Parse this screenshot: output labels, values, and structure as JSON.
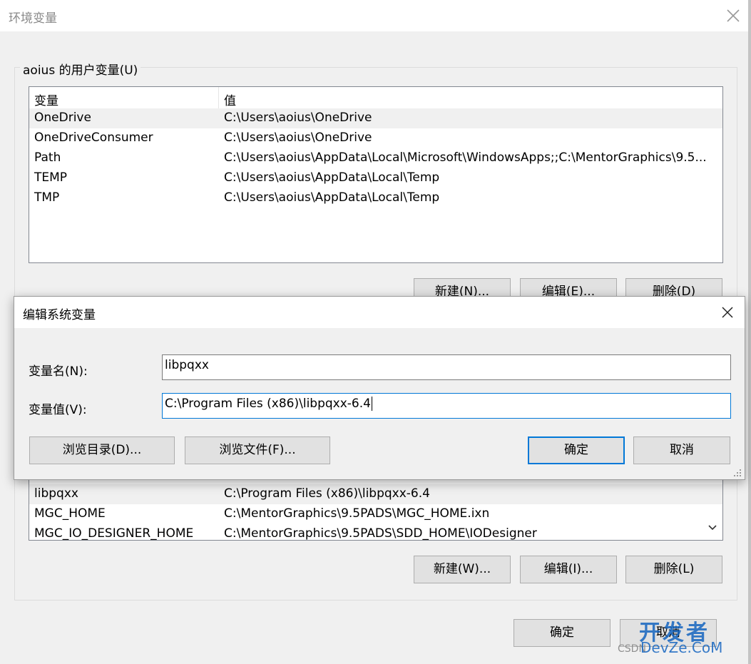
{
  "background_dialog": {
    "title": "环境变量",
    "user_group_label": "aoius 的用户变量(U)",
    "user_table": {
      "columns": [
        "变量",
        "值"
      ],
      "rows": [
        {
          "name": "OneDrive",
          "value": "C:\\Users\\aoius\\OneDrive"
        },
        {
          "name": "OneDriveConsumer",
          "value": "C:\\Users\\aoius\\OneDrive"
        },
        {
          "name": "Path",
          "value": "C:\\Users\\aoius\\AppData\\Local\\Microsoft\\WindowsApps;;C:\\MentorGraphics\\9.5..."
        },
        {
          "name": "TEMP",
          "value": "C:\\Users\\aoius\\AppData\\Local\\Temp"
        },
        {
          "name": "TMP",
          "value": "C:\\Users\\aoius\\AppData\\Local\\Temp"
        }
      ]
    },
    "user_buttons": {
      "new": "新建(N)...",
      "edit": "编辑(E)...",
      "delete": "删除(D)"
    },
    "system_table": {
      "rows": [
        {
          "name": "libpqxx",
          "value": "C:\\Program Files (x86)\\libpqxx-6.4"
        },
        {
          "name": "MGC_HOME",
          "value": "C:\\MentorGraphics\\9.5PADS\\MGC_HOME.ixn"
        },
        {
          "name": "MGC_IO_DESIGNER_HOME",
          "value": "C:\\MentorGraphics\\9.5PADS\\SDD_HOME\\IODesigner"
        }
      ]
    },
    "system_buttons": {
      "new": "新建(W)...",
      "edit": "编辑(I)...",
      "delete": "删除(L)"
    },
    "footer_buttons": {
      "ok": "确定",
      "cancel": "取消"
    }
  },
  "edit_dialog": {
    "title": "编辑系统变量",
    "name_label": "变量名(N):",
    "name_value": "libpqxx",
    "value_label": "变量值(V):",
    "value_value": "C:\\Program Files (x86)\\libpqxx-6.4",
    "browse_dir": "浏览目录(D)...",
    "browse_file": "浏览文件(F)...",
    "ok": "确定",
    "cancel": "取消"
  },
  "watermark": {
    "main": "开发者",
    "sub": "DevZe.CoM",
    "csdn": "CSDN"
  }
}
